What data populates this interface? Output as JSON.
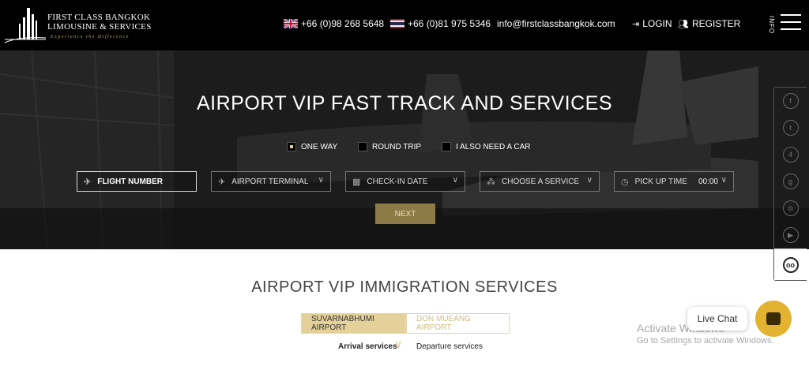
{
  "brand": {
    "line1": "FIRST CLASS BANGKOK",
    "line2": "LIMOUSINE & SERVICES",
    "tagline": "Experience the Difference"
  },
  "header": {
    "phone_uk": "+66 (0)98 268 5648",
    "phone_th": "+66 (0)81 975 5346",
    "email": "info@firstclassbangkok.com",
    "login": "LOGIN",
    "register": "REGISTER",
    "info": "INFO"
  },
  "hero": {
    "title": "AIRPORT VIP FAST TRACK AND SERVICES",
    "trip_options": [
      {
        "label": "ONE WAY",
        "checked": true
      },
      {
        "label": "ROUND TRIP",
        "checked": false
      },
      {
        "label": "I ALSO NEED A CAR",
        "checked": false
      }
    ],
    "fields": {
      "flight_number": "FLIGHT NUMBER",
      "airport_terminal": "AIRPORT TERMINAL",
      "check_in_date": "CHECK-IN DATE",
      "choose_service": "CHOOSE A SERVICE",
      "pickup_time": "PICK UP TIME",
      "pickup_time_value": "00:00"
    },
    "next": "NEXT"
  },
  "section": {
    "title": "AIRPORT VIP IMMIGRATION SERVICES",
    "airports": [
      "SUVARNABHUMI AIRPORT",
      "DON MUEANG AIRPORT"
    ],
    "arrival": "Arrival services",
    "departure": "Departure services"
  },
  "windows": {
    "line1": "Activate Windows",
    "line2": "Go to Settings to activate Windows."
  },
  "chat": {
    "label": "Live Chat"
  },
  "colors": {
    "gold": "#e4d19a",
    "next_button": "#8c7b46",
    "chat_button": "#e3b230"
  }
}
